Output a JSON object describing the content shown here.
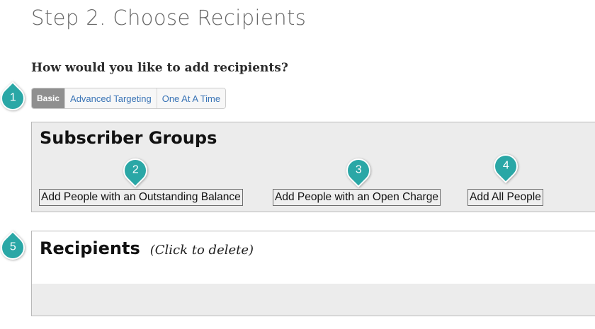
{
  "page": {
    "title": "Step 2. Choose Recipients",
    "question": "How would you like to add recipients?"
  },
  "tabs": [
    {
      "label": "Basic",
      "active": true
    },
    {
      "label": "Advanced Targeting",
      "active": false
    },
    {
      "label": "One At A Time",
      "active": false
    }
  ],
  "subscriber_groups": {
    "heading": "Subscriber Groups",
    "buttons": [
      {
        "label": "Add People with an Outstanding Balance"
      },
      {
        "label": "Add People with an Open Charge"
      },
      {
        "label": "Add All People"
      }
    ]
  },
  "recipients": {
    "heading": "Recipients",
    "hint": "(Click to delete)"
  },
  "callouts": [
    "1",
    "2",
    "3",
    "4",
    "5"
  ],
  "colors": {
    "callout": "#2aa7a6",
    "active_tab": "#8f8f8f",
    "tab_link": "#3a74b6",
    "panel_bg": "#ececec"
  }
}
